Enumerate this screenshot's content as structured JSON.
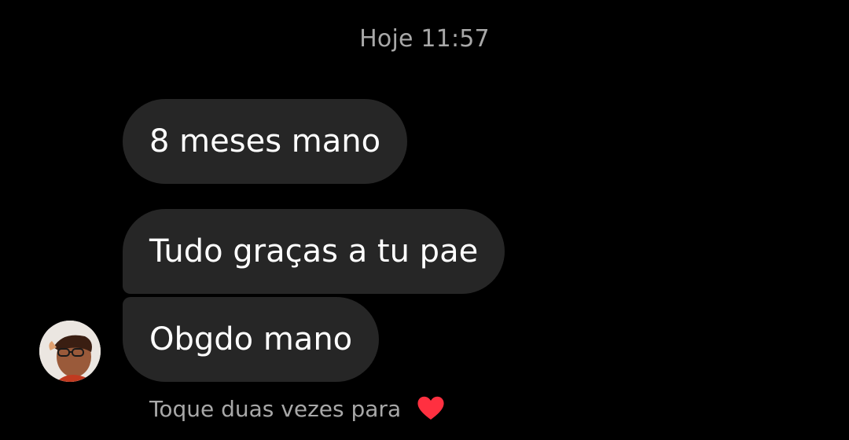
{
  "header": {
    "timestamp": "Hoje 11:57"
  },
  "messages": [
    {
      "text": "8 meses mano"
    },
    {
      "text": "Tudo graças a tu pae"
    },
    {
      "text": "Obgdo mano"
    }
  ],
  "footer": {
    "hint": "Toque duas vezes para",
    "heart_icon": "heart-icon",
    "heart_color": "#ff3040"
  },
  "colors": {
    "background": "#000000",
    "bubble": "#262626",
    "secondary_text": "#a8a8a8"
  }
}
